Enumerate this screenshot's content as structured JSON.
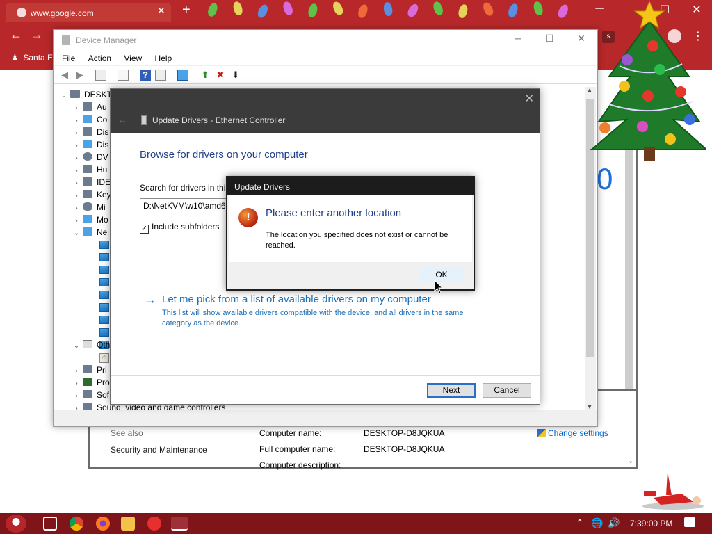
{
  "chrome": {
    "tab_title": "www.google.com",
    "tab_close": "✕",
    "new_tab": "+",
    "back": "←",
    "forward": "→",
    "bookmark": "Santa E",
    "profile_initial": "s",
    "menu": "⋮",
    "minimize": "─",
    "maximize": "☐",
    "close": "✕"
  },
  "device_manager": {
    "title": "Device Manager",
    "minimize": "─",
    "maximize": "☐",
    "close": "✕",
    "menus": [
      "File",
      "Action",
      "View",
      "Help"
    ],
    "tree": [
      {
        "expander": "⌄",
        "label": "DESKT"
      },
      {
        "expander": "›",
        "label": "Au"
      },
      {
        "expander": "›",
        "label": "Co"
      },
      {
        "expander": "›",
        "label": "Dis"
      },
      {
        "expander": "›",
        "label": "Dis"
      },
      {
        "expander": "›",
        "label": "DV"
      },
      {
        "expander": "›",
        "label": "Hu"
      },
      {
        "expander": "›",
        "label": "IDE"
      },
      {
        "expander": "›",
        "label": "Key"
      },
      {
        "expander": "›",
        "label": "Mi"
      },
      {
        "expander": "›",
        "label": "Mo"
      },
      {
        "expander": "⌄",
        "label": "Ne"
      }
    ],
    "tree_lower": [
      {
        "expander": "⌄",
        "label": "Oth"
      },
      {
        "expander": "›",
        "label": "Pri"
      },
      {
        "expander": "›",
        "label": "Pro"
      },
      {
        "expander": "›",
        "label": "Sof"
      },
      {
        "expander": "›",
        "label": "Sound, video and game controllers"
      }
    ],
    "scroll_up": "▲",
    "scroll_down": "▼"
  },
  "wizard": {
    "close": "✕",
    "back": "←",
    "title": "Update Drivers - Ethernet Controller",
    "heading": "Browse for drivers on your computer",
    "search_label": "Search for drivers in this",
    "path_value": "D:\\NetKVM\\w10\\amd6",
    "include_subfolders_label": "Include subfolders",
    "include_subfolders_checked": "✓",
    "pick_arrow": "→",
    "pick_title": "Let me pick from a list of available drivers on my computer",
    "pick_desc": "This list will show available drivers compatible with the device, and all drivers in the same category as the device.",
    "next_label": "Next",
    "cancel_label": "Cancel"
  },
  "error_dialog": {
    "title": "Update Drivers",
    "icon": "!",
    "heading": "Please enter another location",
    "message": "The location you specified does not exist or cannot be reached.",
    "ok_label": "OK"
  },
  "system_properties": {
    "see_also": "See also",
    "security": "Security and Maintenance",
    "computer_name_label": "Computer name:",
    "full_computer_name_label": "Full computer name:",
    "computer_description_label": "Computer description:",
    "computer_name_value": "DESKTOP-D8JQKUA",
    "full_computer_name_value": "DESKTOP-D8JQKUA",
    "change_settings": "Change settings",
    "scroll_down": "⌄",
    "partial_number": "0"
  },
  "taskbar": {
    "time": "7:39:00 PM",
    "tray_up": "⌃",
    "tray_globe": "🌐",
    "tray_volume": "🔊"
  },
  "colors": {
    "chrome_red": "#b8282a",
    "taskbar_red": "#7f1419",
    "link_blue": "#1d6fb8",
    "heading_blue": "#1f3f8a"
  }
}
